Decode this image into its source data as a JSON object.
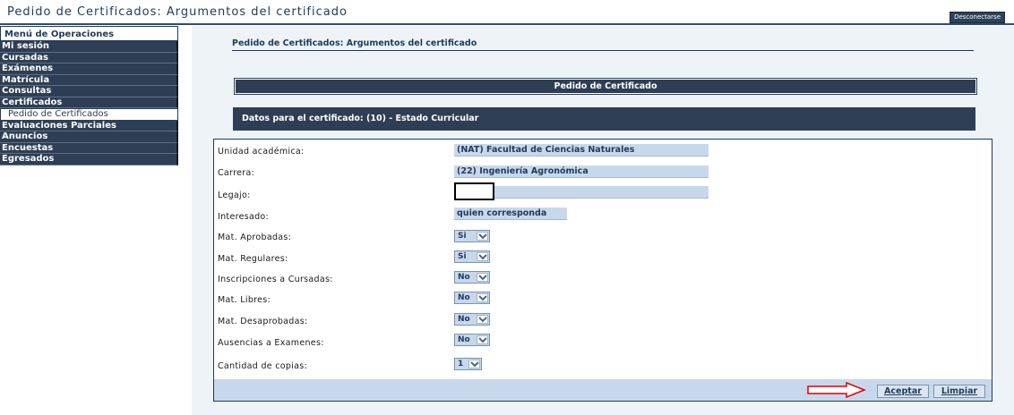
{
  "window": {
    "title": "Pedido de Certificados: Argumentos del certificado",
    "logout_label": "Desconectarse"
  },
  "sidebar": {
    "header": "Menú de Operaciones",
    "items": [
      {
        "label": "Mi sesión"
      },
      {
        "label": "Cursadas"
      },
      {
        "label": "Exámenes"
      },
      {
        "label": "Matrícula"
      },
      {
        "label": "Consultas"
      },
      {
        "label": "Certificados"
      },
      {
        "label": "Pedido de Certificados",
        "sub": true
      },
      {
        "label": "Evaluaciones Parciales"
      },
      {
        "label": "Anuncios"
      },
      {
        "label": "Encuestas"
      },
      {
        "label": "Egresados"
      }
    ]
  },
  "main": {
    "page_title": "Pedido de Certificados: Argumentos del certificado",
    "banner": "Pedido de Certificado",
    "datos": "Datos para el certificado: (10) - Estado Curricular",
    "form": {
      "unidad_label": "Unidad académica:",
      "unidad_value": "(NAT) Facultad de Ciencias Naturales",
      "carrera_label": "Carrera:",
      "carrera_value": "(22) Ingeniería Agronómica",
      "legajo_label": "Legajo:",
      "legajo_value": "",
      "interesado_label": "Interesado:",
      "interesado_value": "quien corresponda",
      "aprobadas_label": "Mat. Aprobadas:",
      "aprobadas_value": "Si",
      "regulares_label": "Mat. Regulares:",
      "regulares_value": "Si",
      "inscripciones_label": "Inscripciones a Cursadas:",
      "inscripciones_value": "No",
      "libres_label": "Mat. Libres:",
      "libres_value": "No",
      "desaprobadas_label": "Mat. Desaprobadas:",
      "desaprobadas_value": "No",
      "ausencias_label": "Ausencias a Examenes:",
      "ausencias_value": "No",
      "copias_label": "Cantidad de copias:",
      "copias_value": "1"
    },
    "buttons": {
      "accept": "Aceptar",
      "clear": "Limpiar"
    }
  },
  "colors": {
    "nav_dark": "#2e3f55",
    "field_fill": "#c8d8ec",
    "arrow_red": "#e00000"
  }
}
